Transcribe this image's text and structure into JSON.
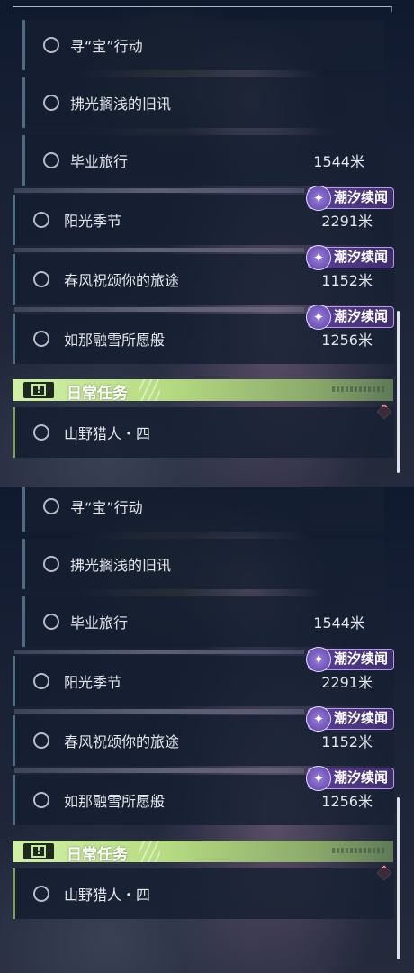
{
  "panels": [
    {
      "quests": [
        {
          "label": "寻“宝”行动",
          "distance": "",
          "badge": ""
        },
        {
          "label": "拂光搁浅的旧讯",
          "distance": "",
          "badge": ""
        },
        {
          "label": "毕业旅行",
          "distance": "1544米",
          "badge": ""
        },
        {
          "label": "阳光季节",
          "distance": "2291米",
          "badge": "潮汐续闻"
        },
        {
          "label": "春风祝颂你的旅途",
          "distance": "1152米",
          "badge": "潮汐续闻"
        },
        {
          "label": "如那融雪所愿般",
          "distance": "1256米",
          "badge": "潮汐续闻"
        }
      ],
      "daily": {
        "title": "日常任务",
        "icon": "exclamation-icon",
        "items": [
          {
            "label": "山野猎人・四"
          }
        ]
      }
    },
    {
      "quests": [
        {
          "label": "寻“宝”行动",
          "distance": "",
          "badge": ""
        },
        {
          "label": "拂光搁浅的旧讯",
          "distance": "",
          "badge": ""
        },
        {
          "label": "毕业旅行",
          "distance": "1544米",
          "badge": ""
        },
        {
          "label": "阳光季节",
          "distance": "2291米",
          "badge": "潮汐续闻"
        },
        {
          "label": "春风祝颂你的旅途",
          "distance": "1152米",
          "badge": "潮汐续闻"
        },
        {
          "label": "如那融雪所愿般",
          "distance": "1256米",
          "badge": "潮汐续闻"
        }
      ],
      "daily": {
        "title": "日常任务",
        "icon": "exclamation-icon",
        "items": [
          {
            "label": "山野猎人・四"
          }
        ]
      }
    }
  ],
  "icons": {
    "quest_status": "circle-icon",
    "badge": "tidal-sparkle-icon",
    "marker": "diamond-icon"
  },
  "colors": {
    "badge_bg": "#4a3680",
    "daily_header": "#b6dc82",
    "marker": "#d9475a"
  }
}
